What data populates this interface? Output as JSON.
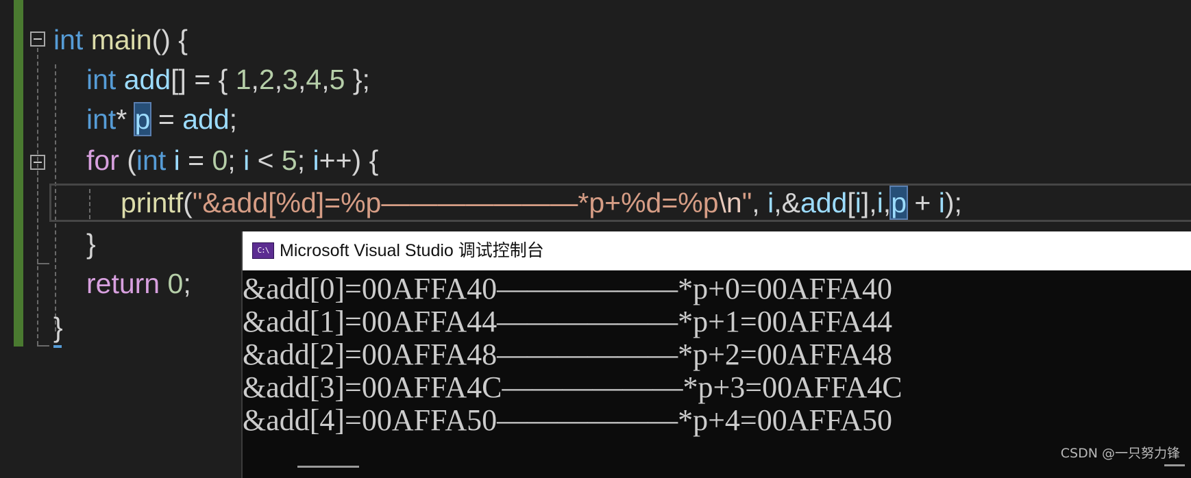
{
  "editor": {
    "line1": {
      "kw": "int",
      "fn": "main",
      "rest": "() {"
    },
    "line2": {
      "kw": "int",
      "var": "add",
      "br": "[] = { ",
      "nums": [
        "1",
        "2",
        "3",
        "4",
        "5"
      ],
      "end": " };"
    },
    "line3": {
      "kw": "int",
      "star": "* ",
      "sel": "p",
      "mid": " = ",
      "var": "add",
      "end": ";"
    },
    "line4": {
      "ctl": "for",
      "p1": " (",
      "kw": "int",
      "p2": " ",
      "i1": "i",
      "p3": " = ",
      "n0": "0",
      "p4": "; ",
      "i2": "i",
      "p5": " < ",
      "n5": "5",
      "p6": "; ",
      "i3": "i",
      "p7": "++) {"
    },
    "line5": {
      "fn": "printf",
      "p1": "(",
      "str1": "\"&add[%d]=%p———————*p+%d=%p",
      "esc": "\\n",
      "str2": "\"",
      "p2": ", ",
      "i1": "i",
      "p3": ",&",
      "var": "add",
      "p4": "[",
      "i2": "i",
      "p5": "],",
      "i3": "i",
      "p6": ",",
      "sel": "p",
      "p7": " + ",
      "i4": "i",
      "p8": ");"
    },
    "line6": {
      "brace": "}"
    },
    "line7": {
      "ctl": "return",
      "sp": " ",
      "num": "0",
      "end": ";"
    },
    "line8": {
      "brace": "}"
    }
  },
  "console": {
    "icon_text": "C:\\",
    "title": "Microsoft Visual Studio 调试控制台",
    "output": [
      "&add[0]=00AFFA40——————*p+0=00AFFA40",
      "&add[1]=00AFFA44——————*p+1=00AFFA44",
      "&add[2]=00AFFA48——————*p+2=00AFFA48",
      "&add[3]=00AFFA4C——————*p+3=00AFFA4C",
      "&add[4]=00AFFA50——————*p+4=00AFFA50"
    ]
  },
  "watermark": "CSDN @一只努力锋"
}
